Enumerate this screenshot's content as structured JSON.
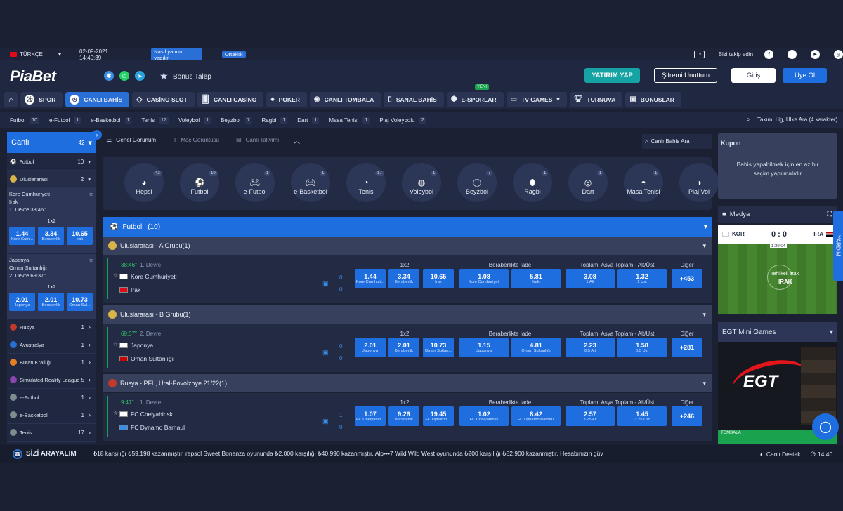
{
  "topbar": {
    "language": "TÜRKÇE",
    "datetime": "02-09-2021 14:40:39",
    "link1": "Nasıl yatırım yapılır",
    "link2": "Ortaklık",
    "follow": "Bizi takip edin"
  },
  "header": {
    "logo": "PiaBet",
    "bonus": "Bonus Talep",
    "deposit": "YATIRIM YAP",
    "forgot": "Şifremi Unuttum",
    "login": "Giriş",
    "signup": "Üye Ol",
    "new_badge": "YENİ"
  },
  "nav": [
    "SPOR",
    "CANLI BAHİS",
    "CASİNO SLOT",
    "CANLI CASİNO",
    "POKER",
    "CANLI TOMBALA",
    "SANAL BAHİS",
    "E-SPORLAR",
    "TV GAMES",
    "TURNUVA",
    "BONUSLAR"
  ],
  "sportsbar": {
    "items": [
      {
        "name": "Futbol",
        "count": "10"
      },
      {
        "name": "e-Futbol",
        "count": "1"
      },
      {
        "name": "e-Basketbol",
        "count": "1"
      },
      {
        "name": "Tenis",
        "count": "17"
      },
      {
        "name": "Voleybol",
        "count": "1"
      },
      {
        "name": "Beyzbol",
        "count": "7"
      },
      {
        "name": "Ragbi",
        "count": "1"
      },
      {
        "name": "Dart",
        "count": "1"
      },
      {
        "name": "Masa Tenisi",
        "count": "1"
      },
      {
        "name": "Plaj Voleybolu",
        "count": "2"
      }
    ],
    "search_placeholder": "Takım, Lig, Ülke Ara (4 karakter)"
  },
  "left": {
    "title": "Canlı",
    "count": "42",
    "futbol": "Futbol",
    "futbol_count": "10",
    "group": "Uluslararası",
    "group_count": "2",
    "m1": {
      "home": "Kore Cumhuriyeti",
      "away": "Irak",
      "time": "1. Devre 38:46\"",
      "market": "1x2",
      "odds": [
        "1.44",
        "3.34",
        "10.65"
      ],
      "labels": [
        "Kore Cum...",
        "Beraberlik",
        "Irak"
      ]
    },
    "m2": {
      "home": "Japonya",
      "away": "Oman Sultanlığı",
      "time": "2. Devre 69:37\"",
      "market": "1x2",
      "odds": [
        "2.01",
        "2.01",
        "10.73"
      ],
      "labels": [
        "Japonya",
        "Beraberlik",
        "Oman Sul..."
      ]
    },
    "countries": [
      {
        "name": "Rusya",
        "count": "1"
      },
      {
        "name": "Avustralya",
        "count": "1"
      },
      {
        "name": "Butan Krallığı",
        "count": "1"
      },
      {
        "name": "Simulated Reality League",
        "count": "5"
      },
      {
        "name": "e-Futbol",
        "count": "1"
      },
      {
        "name": "e-Basketbol",
        "count": "1"
      },
      {
        "name": "Tenis",
        "count": "17"
      }
    ]
  },
  "main": {
    "views": [
      "Genel Görünüm",
      "Maç Görüntüsü",
      "Canlı Takvimi"
    ],
    "search": "Canlı Bahis Ara",
    "circles": [
      {
        "name": "Hepsi",
        "count": "42"
      },
      {
        "name": "Futbol",
        "count": "10"
      },
      {
        "name": "e-Futbol",
        "count": "1"
      },
      {
        "name": "e-Basketbol",
        "count": "1"
      },
      {
        "name": "Tenis",
        "count": "17"
      },
      {
        "name": "Voleybol",
        "count": "1"
      },
      {
        "name": "Beyzbol",
        "count": "7"
      },
      {
        "name": "Ragbi",
        "count": "1"
      },
      {
        "name": "Dart",
        "count": "1"
      },
      {
        "name": "Masa Tenisi",
        "count": "1"
      },
      {
        "name": "Plaj Vol",
        "count": ""
      }
    ],
    "section": "Futbol",
    "section_count": "(10)",
    "col_1x2": "1x2",
    "col_draw": "Beraberlikte İade",
    "col_total": "Toplam, Asya Toplam - Alt/Üst",
    "col_other": "Diğer",
    "matches": [
      {
        "group": "Uluslararası - A Grubu(1)",
        "time": "38:46\"",
        "period": "1. Devre",
        "home": "Kore Cumhuriyeti",
        "away": "Irak",
        "odds": [
          [
            "1.44",
            "Kore Cumhuri..."
          ],
          [
            "3.34",
            "Beraberlik"
          ],
          [
            "10.65",
            "Irak"
          ],
          [
            "1.08",
            "Kore Cumhuriyeti"
          ],
          [
            "5.81",
            "Irak"
          ],
          [
            "3.08",
            "1 Alt"
          ],
          [
            "1.32",
            "1 Üst"
          ]
        ],
        "more": "+453"
      },
      {
        "group": "Uluslararası - B Grubu(1)",
        "time": "69:37\"",
        "period": "2. Devre",
        "home": "Japonya",
        "away": "Oman Sultanlığı",
        "odds": [
          [
            "2.01",
            "Japonya"
          ],
          [
            "2.01",
            "Beraberlik"
          ],
          [
            "10.73",
            "Oman Sultan..."
          ],
          [
            "1.15",
            "Japonya"
          ],
          [
            "4.81",
            "Oman Sultanlığı"
          ],
          [
            "2.23",
            "0.5 Alt"
          ],
          [
            "1.58",
            "0.5 Üst"
          ]
        ],
        "more": "+281"
      },
      {
        "group": "Rusya - PFL, Ural-Povolzhye 21/22(1)",
        "time": "9:47\"",
        "period": "1. Devre",
        "home": "FC Chelyabinsk",
        "away": "FC Dynamo Barnaul",
        "odds": [
          [
            "1.07",
            "FC Chelyabin..."
          ],
          [
            "9.26",
            "Beraberlik"
          ],
          [
            "19.45",
            "FC Dynamo ..."
          ],
          [
            "1.02",
            "FC Chelyabinsk"
          ],
          [
            "8.42",
            "FC Dynamo Barnaul"
          ],
          [
            "2.57",
            "3.25 Alt"
          ],
          [
            "1.45",
            "3.25 Üst"
          ]
        ],
        "more": "+246"
      }
    ],
    "scores": [
      [
        "0",
        "0"
      ],
      [
        "0",
        "0"
      ],
      [
        "1",
        "0"
      ]
    ]
  },
  "right": {
    "kupon": "Kupon",
    "kupon_msg": "Bahis yapabilmek için en az bir seçim yapılmalıdır",
    "medya": "Medya",
    "home": "KOR",
    "away": "IRA",
    "score": "0 : 0",
    "clock": "1:39:04",
    "attack": "Tehlikeli atak",
    "attack_team": "IRAK",
    "egt": "EGT Mini Games",
    "egt_logo": "EGT",
    "tombala": "TOMBALA",
    "yardim": "YARDIM"
  },
  "ticker": {
    "call": "SİZİ ARAYALIM",
    "text": "₺18 karşılığı ₺59.198 kazanmıştır.   repsol   Sweet Bonanza oyununda ₺2.000 karşılığı ₺40.990 kazanmıştır.   Alp•••7   Wild Wild West oyununda ₺200 karşılığı ₺52.900 kazanmıştır.   Hesabınızın güv",
    "support": "Canlı Destek",
    "time": "14:40"
  }
}
